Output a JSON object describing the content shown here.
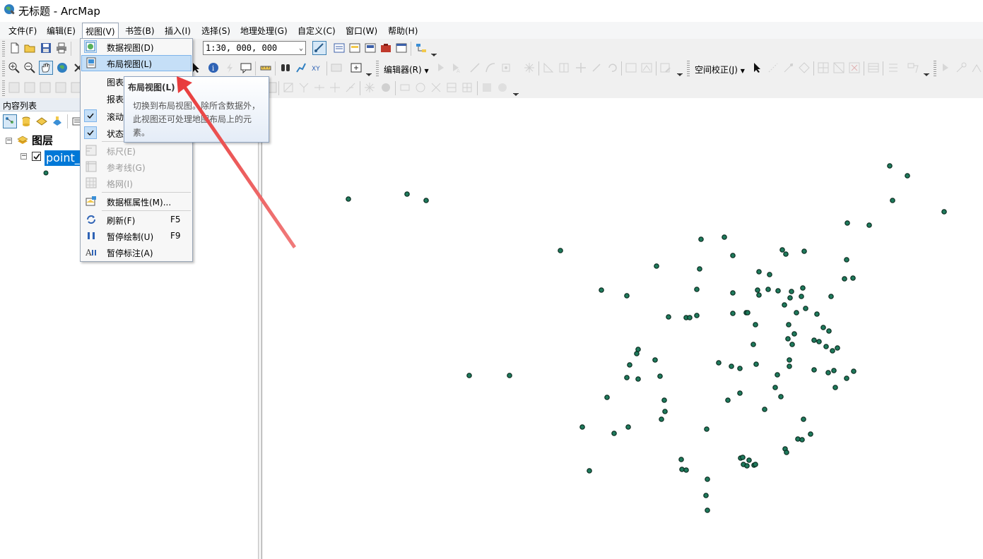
{
  "window": {
    "title": "无标题 - ArcMap",
    "app_icon": "arcmap-globe-icon"
  },
  "menubar": {
    "items": [
      "文件(F)",
      "编辑(E)",
      "视图(V)",
      "书签(B)",
      "插入(I)",
      "选择(S)",
      "地理处理(G)",
      "自定义(C)",
      "窗口(W)",
      "帮助(H)"
    ],
    "active": "视图(V)"
  },
  "toolbar": {
    "scale_value": "1:30, 000, 000",
    "editor_label": "编辑器(R)",
    "spatial_adjust_label": "空间校正(J)"
  },
  "toc": {
    "title": "内容列表",
    "root_label": "图层",
    "layer_name": "point_"
  },
  "view_menu": {
    "items": [
      {
        "label": "数据视图(D)",
        "icon": "data-view-icon"
      },
      {
        "label": "布局视图(L)",
        "icon": "layout-view-icon",
        "highlighted": true
      },
      {
        "label": "图表"
      },
      {
        "label": "报表"
      },
      {
        "label": "滚动",
        "checked": true
      },
      {
        "label": "状态",
        "checked": true
      },
      {
        "label": "标尺(E)",
        "disabled": true,
        "icon": "ruler-icon"
      },
      {
        "label": "参考线(G)",
        "disabled": true,
        "icon": "guides-icon"
      },
      {
        "label": "格网(I)",
        "disabled": true,
        "icon": "grid-icon"
      },
      {
        "label": "数据框属性(M)...",
        "icon": "data-frame-properties-icon"
      },
      {
        "label": "刷新(F)",
        "shortcut": "F5",
        "icon": "refresh-icon"
      },
      {
        "label": "暂停绘制(U)",
        "shortcut": "F9",
        "icon": "pause-drawing-icon"
      },
      {
        "label": "暂停标注(A)",
        "icon": "pause-labeling-icon"
      }
    ]
  },
  "tooltip": {
    "title": "布局视图(L)",
    "body": "切换到布局视图。除所含数据外，此视图还可处理地图布局上的元素。"
  },
  "colors": {
    "point_fill": "#1e7a5c",
    "point_stroke": "#0a2a1e",
    "annotation_arrow": "#e83a3a",
    "selection_blue": "#0078d7",
    "menu_highlight": "#c5dff7"
  }
}
